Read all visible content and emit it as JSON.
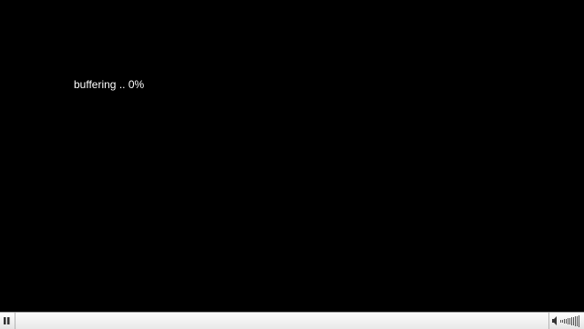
{
  "video": {
    "buffering_text": "buffering .. 0%",
    "buffering_percent": 0
  },
  "controls": {
    "play_state_icon": "pause-icon",
    "speaker_icon": "speaker-icon",
    "volume_icon": "volume-level-icon",
    "seek_progress_fraction": 0
  },
  "colors": {
    "video_background": "#000000",
    "text": "#ffffff",
    "controlbar": "#ececec"
  }
}
